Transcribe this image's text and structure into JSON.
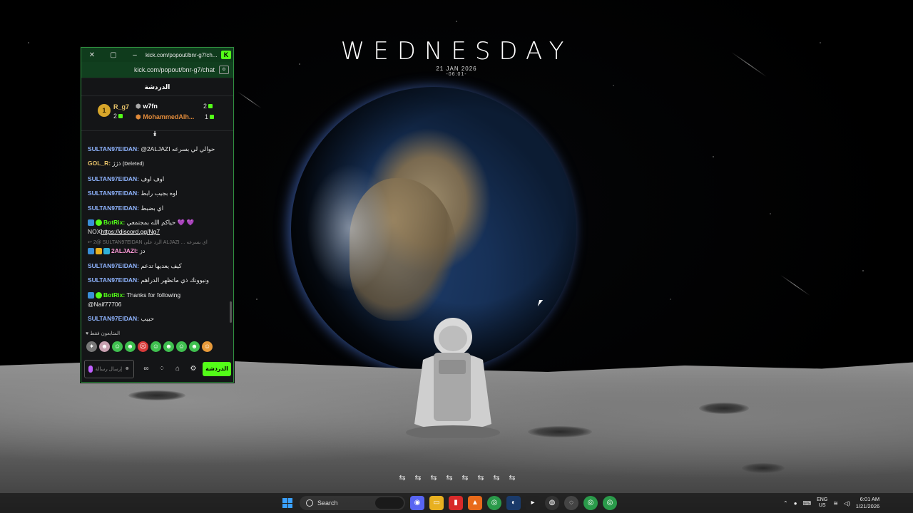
{
  "clock": {
    "day": "WEDNESDAY",
    "date": "21 JAN 2026",
    "time": "-06:01-"
  },
  "chat_window": {
    "title_url": "kick.com/popout/bnr-g7/ch...",
    "address": "kick.com/popout/bnr-g7/chat",
    "chat_title": "الدردشة",
    "leaderboard": [
      {
        "rank": "1",
        "name": "R_g7",
        "count": "2"
      },
      {
        "name": "w7fn",
        "count": "2"
      },
      {
        "name": "MohammedAlh...",
        "count": "1"
      }
    ],
    "messages": [
      {
        "user": "SULTAN97EIDAN:",
        "text": "@2ALJAZI حوالي لي بسرعه"
      },
      {
        "user": "GOL_R:",
        "text": "ذژژ",
        "extra": "(Deleted)"
      },
      {
        "user": "SULTAN97EIDAN:",
        "text": "اوف اوف"
      },
      {
        "user": "SULTAN97EIDAN:",
        "text": "اوه بجيب رابط"
      },
      {
        "user": "SULTAN97EIDAN:",
        "text": "اي بضبط"
      },
      {
        "user": "BotRix:",
        "text": "حياكم الله بمجتمعي 💜 💜",
        "text2": "NOX",
        "link": "https://discord.gg/Ng7"
      },
      {
        "reply": "2@ SULTAN97EIDAN الرد على ALJAZI ... اي بسرعه",
        "user": "2ALJAZI:",
        "text": "دز"
      },
      {
        "user": "SULTAN97EIDAN:",
        "text": "كيف يعديها تدعم"
      },
      {
        "user": "SULTAN97EIDAN:",
        "text": "ونيوونك ذي ماتظهر الدراهم"
      },
      {
        "user": "BotRix:",
        "text": "Thanks for following",
        "text2": "@Naif77706"
      },
      {
        "user": "SULTAN97EIDAN:",
        "text": "حبيب"
      }
    ],
    "emotes_label": "المتابعون فقط",
    "input_placeholder": "إرسال رسالة",
    "send_label": "الدردشة"
  },
  "taskbar": {
    "search_label": "Search",
    "language": "ENG",
    "region": "US",
    "time": "6:01 AM",
    "date": "1/21/2026"
  },
  "colors": {
    "accent": "#53fc18",
    "username": "#8fb4ff",
    "window_bg": "#141517"
  }
}
